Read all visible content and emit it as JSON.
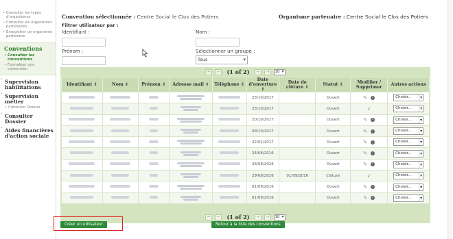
{
  "sidebar": {
    "top_items": [
      "Consulter les types d'organismes",
      "Consulter les organismes partenaires",
      "Enregistrer un organisme partenaire"
    ],
    "conventions": {
      "title": "Conventions",
      "items": [
        "Consulter les conventions",
        "Formaliser une convention"
      ]
    },
    "supervision_habilitations": "Supervision habilitations",
    "supervision_metier": "Supervision métier",
    "supervision_metier_item": "Consulter Dossier",
    "consulter_dossier": "Consulter Dossier",
    "aides": "Aides financières d'action sociale"
  },
  "header": {
    "convention_label": "Convention sélectionnée :",
    "convention_value": "Centre Social le Clos des Potiers",
    "organisme_label": "Organisme partenaire :",
    "organisme_value": "Centre Social le Clos des Potiers"
  },
  "filter": {
    "title": "Filtrer utilisateur par :",
    "identifiant_label": "Identifiant :",
    "nom_label": "Nom :",
    "prenom_label": "Prénom :",
    "groupe_label": "Sélectionner un groupe :",
    "groupe_value": "Tous"
  },
  "pager": {
    "info": "(1 of 2)",
    "per_page": "10",
    "first": "⇤",
    "prev": "←",
    "next": "→",
    "last": "⇥"
  },
  "table": {
    "columns": [
      "Identifiant ⇕",
      "Nom ⇕",
      "Prénom ⇕",
      "Adresse mail ⇕",
      "Téléphone ⇕",
      "Date d'ouverture ⇕",
      "Date de clôture ⇕",
      "Statut ⇕",
      "Modifier / Supprimer",
      "Autres actions"
    ],
    "rows": [
      {
        "ouverture": "23/10/2017",
        "cloture": "",
        "statut": "Ouvert",
        "action": "edit"
      },
      {
        "ouverture": "23/10/2017",
        "cloture": "",
        "statut": "Ouvert",
        "action": "check"
      },
      {
        "ouverture": "20/10/2017",
        "cloture": "",
        "statut": "Ouvert",
        "action": "edit"
      },
      {
        "ouverture": "09/10/2017",
        "cloture": "",
        "statut": "Ouvert",
        "action": "edit"
      },
      {
        "ouverture": "22/02/2017",
        "cloture": "",
        "statut": "Ouvert",
        "action": "edit"
      },
      {
        "ouverture": "24/08/2016",
        "cloture": "",
        "statut": "Ouvert",
        "action": "edit"
      },
      {
        "ouverture": "26/08/2016",
        "cloture": "",
        "statut": "Ouvert",
        "action": "edit"
      },
      {
        "ouverture": "29/08/2016",
        "cloture": "01/09/2016",
        "statut": "Clôturé",
        "action": "check"
      },
      {
        "ouverture": "01/09/2016",
        "cloture": "",
        "statut": "Ouvert",
        "action": "edit"
      },
      {
        "ouverture": "01/09/2016",
        "cloture": "",
        "statut": "Ouvert",
        "action": "edit"
      }
    ],
    "choisir": "Choisir..."
  },
  "buttons": {
    "create_user": "Créer un utilisateur",
    "back": "Retour à la liste des conventions"
  },
  "colors": {
    "accent_green": "#2f8a3b",
    "table_bg": "#d4e4c0",
    "highlight_red": "#e02020"
  }
}
